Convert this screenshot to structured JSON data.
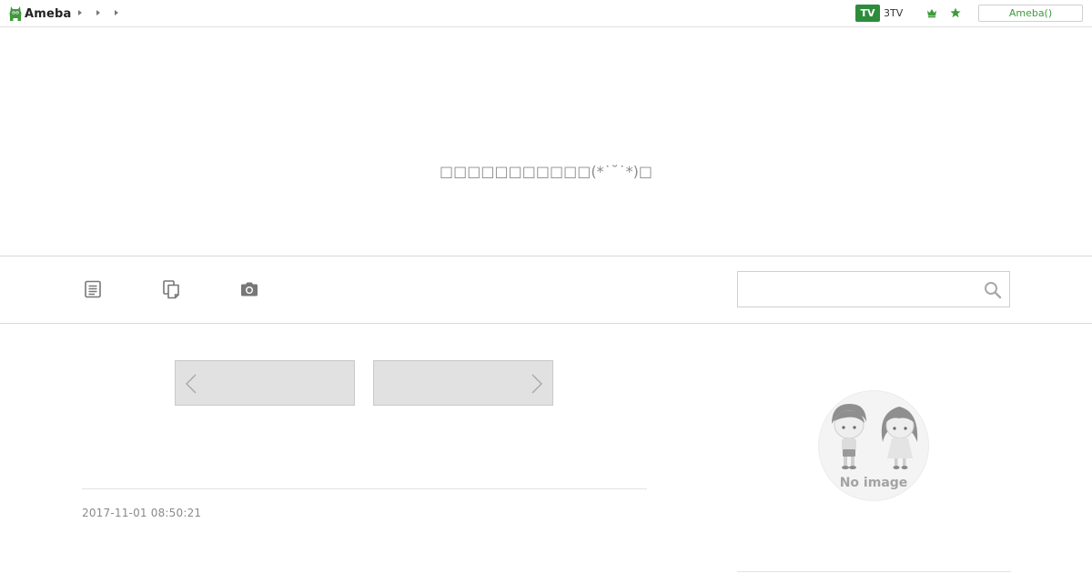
{
  "header": {
    "logo_text": "Ameba",
    "tv_badge": "TV",
    "tv_label": "3TV",
    "login_label": "Ameba()",
    "colors": {
      "brand_green": "#3e9a3a",
      "tv_green": "#2d8c3c"
    },
    "icons": [
      "crown-icon",
      "star-icon"
    ]
  },
  "hero": {
    "message": "□□□□□□□□□□□(*˙˘˙*)□"
  },
  "nav": {
    "icons": [
      "entry-list-icon",
      "documents-icon",
      "camera-icon"
    ],
    "search": {
      "placeholder": "",
      "icon": "search-icon"
    }
  },
  "pager": {
    "prev_icon": "chevron-left-icon",
    "next_icon": "chevron-right-icon"
  },
  "article": {
    "date": "2017-11-01 08:50:21"
  },
  "sidebar": {
    "profile_image_text": "No image"
  }
}
